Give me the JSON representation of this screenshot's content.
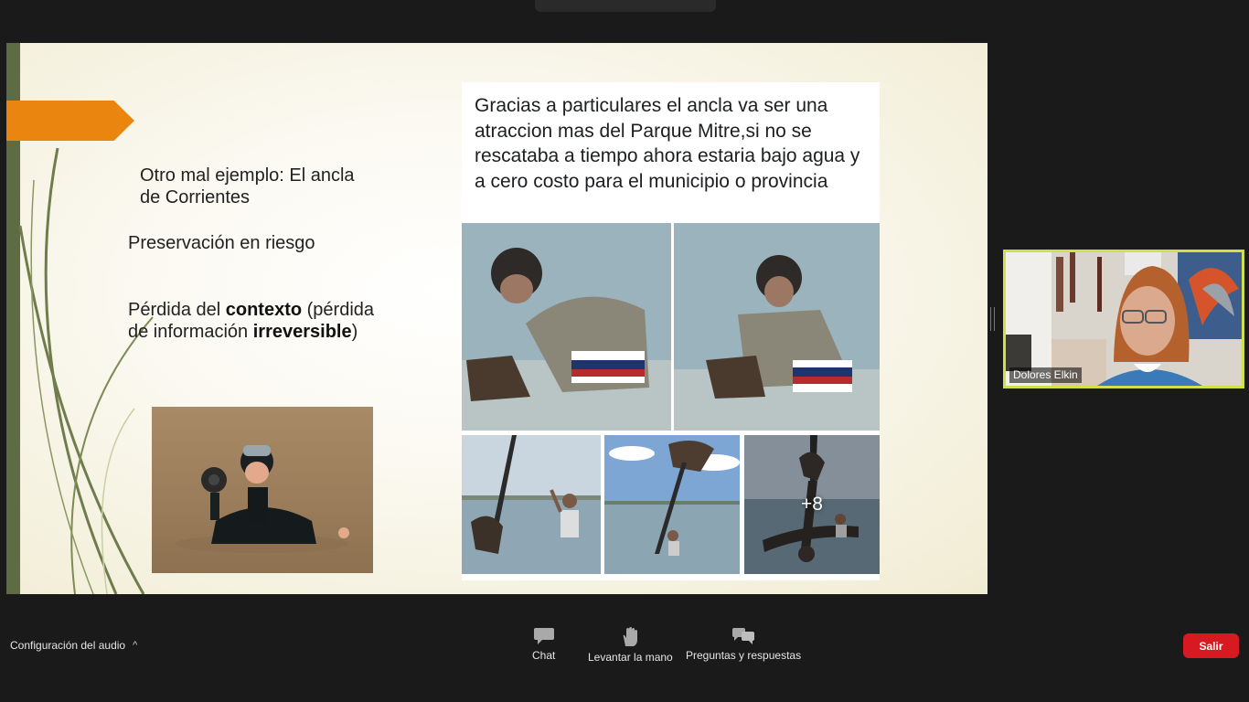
{
  "slide": {
    "title": "Otro mal ejemplo: El ancla de Corrientes",
    "preservation": "Preservación en riesgo",
    "context_loss": {
      "prefix": "Pérdida del ",
      "bold1": "contexto",
      "middle": " (pérdida de información ",
      "bold2": "irreversible",
      "suffix": ")"
    },
    "facebook_post": {
      "text": "Gracias a particulares el ancla va ser una atraccion mas del Parque Mitre,si no se rescataba a tiempo ahora estaria bajo agua y a cero costo para el municipio o provincia",
      "more_photos": "+8"
    }
  },
  "participant": {
    "name": "Dolores Elkin"
  },
  "toolbar": {
    "audio_config": "Configuración del audio",
    "chat": "Chat",
    "raise_hand": "Levantar la mano",
    "qa": "Preguntas y respuestas",
    "leave": "Salir"
  },
  "colors": {
    "accent_orange": "#ea8610",
    "slide_edge_green": "#5e6b43",
    "speaker_border": "#cfe048",
    "leave_red": "#d71a21"
  }
}
